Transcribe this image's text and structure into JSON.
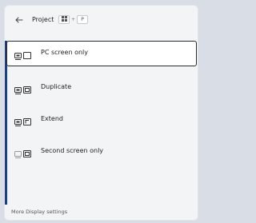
{
  "header": {
    "back_icon": "arrow-left-icon",
    "title": "Project",
    "shortcut": {
      "modifier_icon": "windows-logo-icon",
      "key": "P"
    }
  },
  "options": [
    {
      "label": "PC screen only",
      "icon": "pc-screen-only-icon",
      "selected": true
    },
    {
      "label": "Duplicate",
      "icon": "duplicate-icon",
      "selected": false
    },
    {
      "label": "Extend",
      "icon": "extend-icon",
      "selected": false
    },
    {
      "label": "Second screen only",
      "icon": "second-screen-only-icon",
      "selected": false
    }
  ],
  "footer": {
    "link": "More Display settings"
  },
  "colors": {
    "accent": "#1f3d7a",
    "panel_bg": "#f3f4f6",
    "selected_bg": "#ffffff",
    "selected_border": "#2b2b2b"
  }
}
